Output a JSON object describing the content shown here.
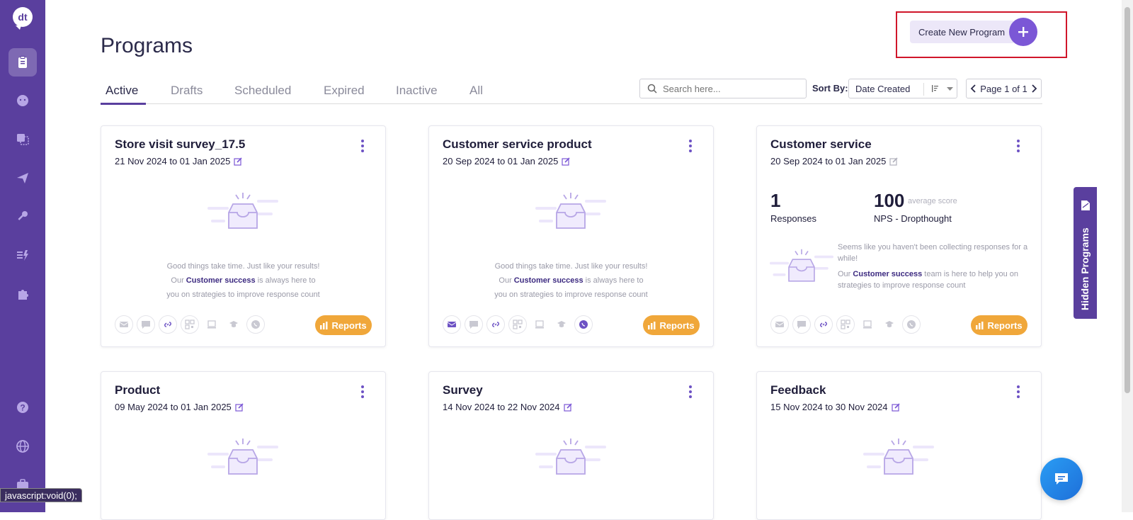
{
  "sidebar": {
    "logo": "dt",
    "icons": [
      "clipboard-icon",
      "smiley-icon",
      "copy-icon",
      "send-icon",
      "key-icon",
      "flash-list-icon",
      "puzzle-icon",
      "help-icon",
      "globe-icon",
      "briefcase-icon"
    ]
  },
  "header": {
    "title": "Programs",
    "create_label": "Create New Program"
  },
  "tabs": [
    {
      "label": "Active"
    },
    {
      "label": "Drafts"
    },
    {
      "label": "Scheduled"
    },
    {
      "label": "Expired"
    },
    {
      "label": "Inactive"
    },
    {
      "label": "All"
    }
  ],
  "toolbar": {
    "search_placeholder": "Search here...",
    "sort_label": "Sort By:",
    "sort_value": "Date Created",
    "page_label": "Page 1 of 1"
  },
  "empty_msg": {
    "line1": "Good things take time. Just like your results!",
    "line2_pre": "Our ",
    "line2_link": "Customer success",
    "line2_post": " is always here to",
    "line3": "you on strategies to improve response count"
  },
  "cards": [
    {
      "title": "Store visit survey_17.5",
      "date": "21 Nov 2024 to 01 Jan 2025"
    },
    {
      "title": "Customer service product",
      "date": "20 Sep 2024 to 01 Jan 2025"
    },
    {
      "title": "Customer service",
      "date": "20 Sep 2024 to 01 Jan 2025",
      "responses_num": "1",
      "responses_label": "Responses",
      "score_num": "100",
      "score_sub": "average score",
      "score_label": "NPS - Dropthought",
      "note1": "Seems like you haven't been collecting responses for a while!",
      "note2_pre": "Our ",
      "note2_link": "Customer success",
      "note2_post": " team is here to help you on strategies to improve response count"
    },
    {
      "title": "Product",
      "date": "09 May 2024 to 01 Jan 2025"
    },
    {
      "title": "Survey",
      "date": "14 Nov 2024 to 22 Nov 2024"
    },
    {
      "title": "Feedback",
      "date": "15 Nov 2024 to 30 Nov 2024"
    }
  ],
  "reports_label": "Reports",
  "hidden_programs_label": "Hidden Programs",
  "status_text": "javascript:void(0);",
  "colors": {
    "primary": "#5a3f9e",
    "accent": "#7b57d6",
    "reports": "#f0a73a",
    "highlight": "#d0162a"
  }
}
